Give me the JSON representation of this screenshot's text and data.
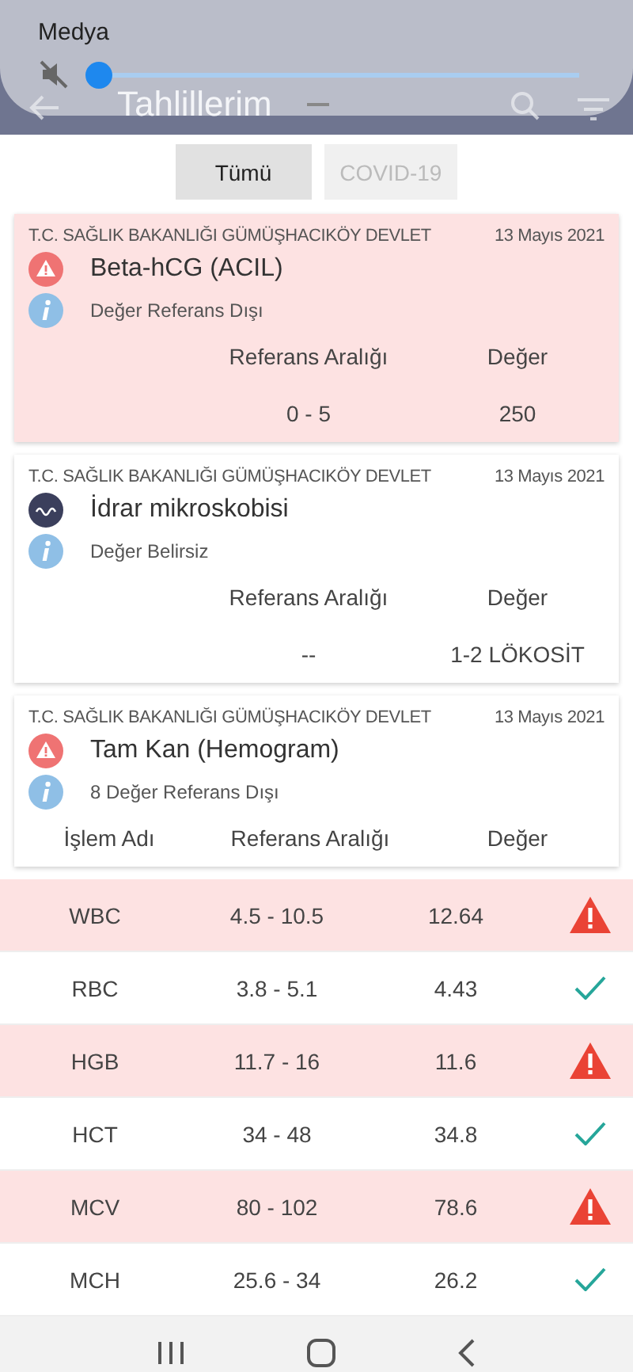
{
  "volume_panel": {
    "label": "Medya",
    "muted": true,
    "level": 0
  },
  "header": {
    "title": "Tahlillerim"
  },
  "tabs": [
    {
      "label": "Tümü",
      "selected": true
    },
    {
      "label": "COVID-19",
      "selected": false
    }
  ],
  "cards": [
    {
      "hospital": "T.C. SAĞLIK BAKANLIĞI GÜMÜŞHACIKÖY DEVLET",
      "date": "13 Mayıs 2021",
      "kind": "warning",
      "flagged": true,
      "test": "Beta-hCG (ACIL)",
      "note": "Değer Referans Dışı",
      "columns": [
        "Referans Aralığı",
        "Değer"
      ],
      "values": [
        "0 - 5",
        "250"
      ]
    },
    {
      "hospital": "T.C. SAĞLIK BAKANLIĞI GÜMÜŞHACIKÖY DEVLET",
      "date": "13 Mayıs 2021",
      "kind": "wave",
      "flagged": false,
      "test": "İdrar mikroskobisi",
      "note": "Değer Belirsiz",
      "columns": [
        "Referans Aralığı",
        "Değer"
      ],
      "values": [
        "--",
        "1-2 LÖKOSİT"
      ]
    },
    {
      "hospital": "T.C. SAĞLIK BAKANLIĞI GÜMÜŞHACIKÖY DEVLET",
      "date": "13 Mayıs 2021",
      "kind": "warning",
      "flagged": false,
      "test": "Tam Kan (Hemogram)",
      "note": "8 Değer Referans Dışı",
      "columns": [
        "İşlem Adı",
        "Referans Aralığı",
        "Değer"
      ]
    }
  ],
  "rows": [
    {
      "name": "WBC",
      "range": "4.5 - 10.5",
      "value": "12.64",
      "abnormal": true
    },
    {
      "name": "RBC",
      "range": "3.8 - 5.1",
      "value": "4.43",
      "abnormal": false
    },
    {
      "name": "HGB",
      "range": "11.7 - 16",
      "value": "11.6",
      "abnormal": true
    },
    {
      "name": "HCT",
      "range": "34 - 48",
      "value": "34.8",
      "abnormal": false
    },
    {
      "name": "MCV",
      "range": "80 - 102",
      "value": "78.6",
      "abnormal": true
    },
    {
      "name": "MCH",
      "range": "25.6 - 34",
      "value": "26.2",
      "abnormal": false
    }
  ]
}
